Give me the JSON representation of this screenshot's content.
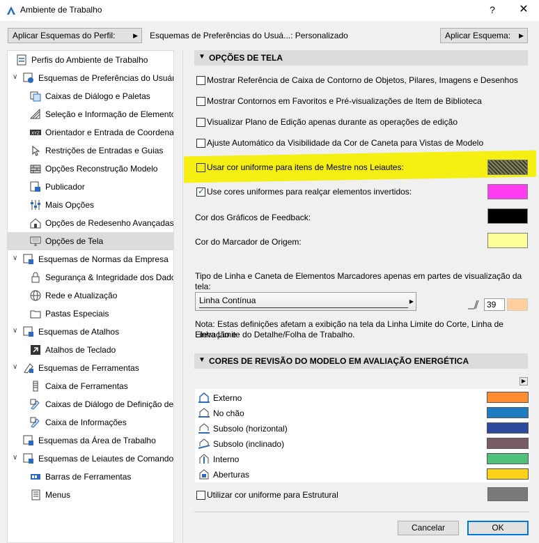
{
  "window": {
    "title": "Ambiente de Trabalho",
    "help": "?",
    "close": "✕"
  },
  "toolbar": {
    "profile_button": "Aplicar Esquemas do Perfil:",
    "scheme_status": "Esquemas de Preferências do Usuá...: Personalizado",
    "apply_button": "Aplicar Esquema:",
    "arrow": "▶"
  },
  "tree": {
    "items": [
      {
        "label": "Perfis do Ambiente de Trabalho",
        "icon": "profile-icon"
      },
      {
        "label": "Esquemas de Preferências do Usuário",
        "icon": "user-preferences-icon",
        "twisty": "∨"
      },
      {
        "label": "Caixas de Diálogo e Paletas",
        "icon": "dialog-palette-icon"
      },
      {
        "label": "Seleção e Informação de Elemento",
        "icon": "selection-icon"
      },
      {
        "label": "Orientador e Entrada de Coordenad",
        "icon": "xyz-icon"
      },
      {
        "label": "Restrições de Entradas e Guias",
        "icon": "cursor-icon"
      },
      {
        "label": "Opções Reconstrução Modelo",
        "icon": "wall-icon"
      },
      {
        "label": "Publicador",
        "icon": "publisher-icon"
      },
      {
        "label": "Mais Opções",
        "icon": "sliders-icon"
      },
      {
        "label": "Opções de Redesenho Avançadas",
        "icon": "house-icon"
      },
      {
        "label": "Opções de Tela",
        "icon": "monitor-icon",
        "selected": true
      },
      {
        "label": "Esquemas de Normas da Empresa",
        "icon": "company-standards-icon",
        "twisty": "∨"
      },
      {
        "label": "Segurança & Integridade dos Dados",
        "icon": "lock-icon"
      },
      {
        "label": "Rede e Atualização",
        "icon": "globe-icon"
      },
      {
        "label": "Pastas Especiais",
        "icon": "folder-icon"
      },
      {
        "label": "Esquemas de Atalhos",
        "icon": "shortcuts-icon",
        "twisty": "∨"
      },
      {
        "label": "Atalhos de Teclado",
        "icon": "arrow-key-icon"
      },
      {
        "label": "Esquemas de Ferramentas",
        "icon": "tools-scheme-icon",
        "twisty": "∨"
      },
      {
        "label": "Caixa de Ferramentas",
        "icon": "toolbox-icon"
      },
      {
        "label": "Caixas de Diálogo de Definição de F",
        "icon": "tool-settings-icon"
      },
      {
        "label": "Caixa de Informações",
        "icon": "info-box-icon"
      },
      {
        "label": "Esquemas da Área de Trabalho",
        "icon": "workspace-icon"
      },
      {
        "label": "Esquemas de Leiautes de Comandos",
        "icon": "command-layout-icon",
        "twisty": "∨"
      },
      {
        "label": "Barras de Ferramentas",
        "icon": "toolbar-icon"
      },
      {
        "label": "Menus",
        "icon": "menu-icon"
      }
    ]
  },
  "screen_options": {
    "section_title": "OPÇÕES DE TELA",
    "caret": "▼",
    "options": [
      {
        "label": "Mostrar Referência de Caixa de Contorno de Objetos, Pilares, Imagens e Desenhos",
        "checked": false
      },
      {
        "label": "Mostrar Contornos em Favoritos e Pré-visualizações de Item de Biblioteca",
        "checked": false
      },
      {
        "label": "Visualizar Plano de Edição apenas durante as operações de edição",
        "checked": false
      },
      {
        "label": "Ajuste Automático da Visibilidade da Cor de Caneta para Vistas de Modelo",
        "checked": false
      }
    ],
    "uniform_master": {
      "label": "Usar cor uniforme para itens de Mestre nos Leiautes:",
      "checked": false
    },
    "uniform_inverted": {
      "label": "Use cores uniformes para realçar elementos invertidos:",
      "checked": true,
      "color": "#ff3cf0"
    },
    "feedback": {
      "label": "Cor dos Gráficos de Feedback:",
      "color": "#000000"
    },
    "origin": {
      "label": "Cor do Marcador de Origem:",
      "color": "#ffff99"
    },
    "marker_text": "Tipo de Linha e Caneta de Elementos Marcadores apenas em partes de visualização da tela:",
    "line_type": "Linha Contínua",
    "pen_number": "39",
    "pen_color": "#ffcf9d",
    "note": "Nota: Estas definições afetam a exibição na tela da Linha Limite do Corte, Linha de Elevação e",
    "note_line2": "Linha Limite do Detalhe/Folha de Trabalho."
  },
  "energy": {
    "section_title": "CORES DE REVISÃO DO MODELO EM AVALIAÇÃO ENERGÉTICA",
    "rows": [
      {
        "label": "Externo",
        "color": "#ff8c2e"
      },
      {
        "label": "No chão",
        "color": "#1f7cc0"
      },
      {
        "label": "Subsolo (horizontal)",
        "color": "#2c4a9e"
      },
      {
        "label": "Subsolo (inclinado)",
        "color": "#7a5c63"
      },
      {
        "label": "Interno",
        "color": "#4ec07a"
      },
      {
        "label": "Aberturas",
        "color": "#ffd21a"
      }
    ],
    "structural": {
      "label": "Utilizar cor uniforme para Estrutural",
      "checked": false,
      "color": "#7a7a7a"
    }
  },
  "dialog": {
    "cancel": "Cancelar",
    "ok": "OK"
  }
}
